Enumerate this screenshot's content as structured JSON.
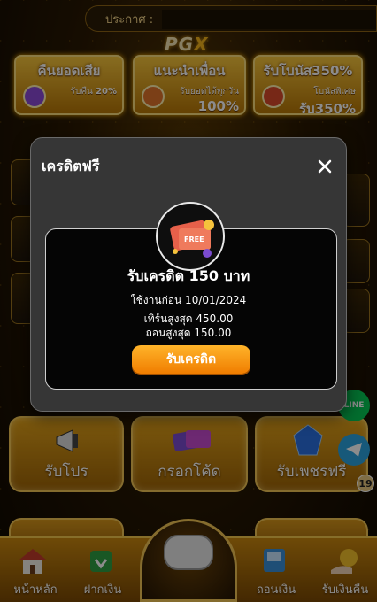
{
  "topbar": {
    "label": "ประกาศ :"
  },
  "logo": {
    "text": "PG",
    "accent": "X"
  },
  "banners": [
    {
      "title": "คืนยอดเสีย",
      "sub": "รับคืน",
      "big": "20%"
    },
    {
      "title": "แนะนำเพื่อน",
      "sub": "รับยอดได้ทุกวัน",
      "big": "100%"
    },
    {
      "title": "รับโบนัส350%",
      "sub": "โบนัสพิเศษ",
      "big": "รับ350%"
    }
  ],
  "tiles": [
    {
      "label": "รับโปร"
    },
    {
      "label": "กรอกโค้ด"
    },
    {
      "label": "รับเพชรฟรี"
    }
  ],
  "social": {
    "line": "LINE",
    "badge": "19"
  },
  "bottom_nav": [
    {
      "label": "หน้าหลัก"
    },
    {
      "label": "ฝากเงิน"
    },
    {
      "label": "ถอนเงิน"
    },
    {
      "label": "รับเงินคืน"
    }
  ],
  "modal": {
    "title": "เครดิตฟรี",
    "coupon_text": "FREE",
    "heading": "รับเครดิต 150 บาท",
    "use_before": "ใช้งานก่อน 10/01/2024",
    "max_turnover": "เทิร์นสูงสุด 450.00",
    "max_withdraw": "ถอนสูงสุด 150.00",
    "claim_label": "รับเครดิต"
  },
  "colors": {
    "accent": "#f07d00",
    "gold": "#f2c555",
    "modal_bg": "#363636"
  },
  "icons": [
    "close-icon",
    "coupon-icon",
    "home-icon",
    "deposit-icon",
    "withdraw-icon",
    "cashback-icon",
    "megaphone-icon",
    "code-icon",
    "gem-icon",
    "line-icon",
    "telegram-icon",
    "gamepad-icon"
  ]
}
